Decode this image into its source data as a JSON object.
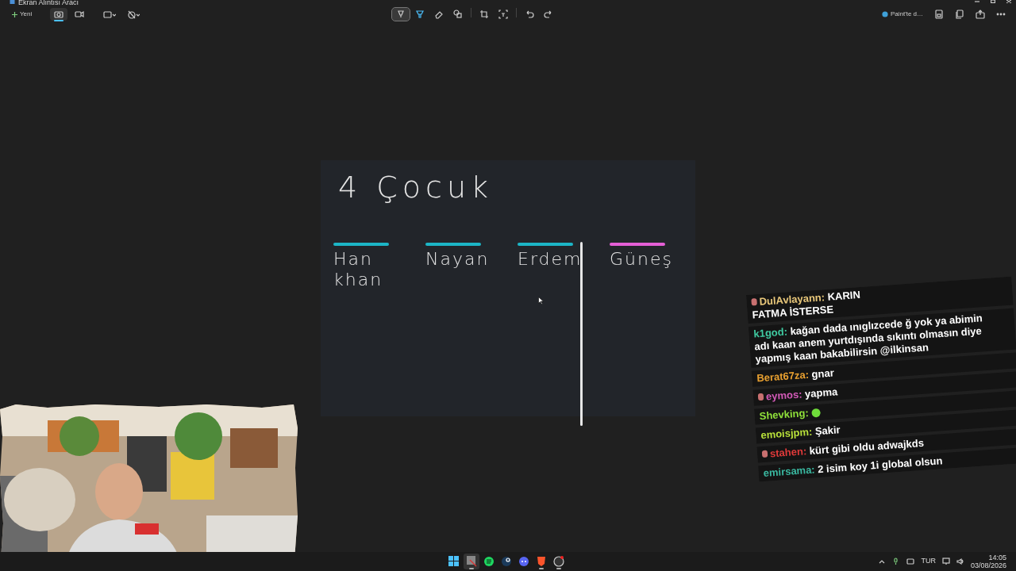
{
  "window": {
    "title": "Ekran Alıntısı Aracı"
  },
  "toolbar": {
    "new_button": "Yeni",
    "capture_modes": [
      {
        "selected": true
      },
      {
        "selected": false
      }
    ],
    "tools": [
      {
        "selected": true
      },
      {
        "selected": false
      },
      {
        "selected": false
      },
      {
        "selected": false
      }
    ],
    "paint_button": "Paint'te d…"
  },
  "canvas": {
    "heading": "4 Çocuk",
    "names": [
      {
        "lines": [
          "Han",
          "khan"
        ],
        "color": "#1cb5c6"
      },
      {
        "lines": [
          "Nayan"
        ],
        "color": "#1cb5c6"
      },
      {
        "lines": [
          "Erdem"
        ],
        "color": "#1cb5c6"
      },
      {
        "lines": [
          "Güneş"
        ],
        "color": "#e45fd6"
      }
    ]
  },
  "chat": [
    {
      "user": "DulAvlayann:",
      "color": "#e8c77a",
      "badge": true,
      "lines": [
        "KARIN",
        "FATMA İSTERSE"
      ]
    },
    {
      "user": "k1god:",
      "color": "#3fc9a0",
      "badge": false,
      "lines": [
        "kağan dada ınıglızcede ğ yok ya abimin",
        "adı kaan anem yurtdışında sıkıntı olmasın diye",
        "yapmış kaan bakabilirsin @ilkinsan"
      ]
    },
    {
      "user": "Berat67za:",
      "color": "#e8a030",
      "badge": false,
      "lines": [
        "gnar"
      ]
    },
    {
      "user": "eymos:",
      "color": "#d35ab8",
      "badge": true,
      "lines": [
        "yapma"
      ]
    },
    {
      "user": "Shevking:",
      "color": "#8fe03a",
      "badge": false,
      "emote": true
    },
    {
      "user": "emoisjpm:",
      "color": "#b8e03a",
      "badge": false,
      "lines": [
        "Şakir"
      ]
    },
    {
      "user": "stahen:",
      "color": "#e03a3a",
      "badge": true,
      "lines": [
        "kürt gibi oldu adwajkds"
      ]
    },
    {
      "user": "emirsama:",
      "color": "#3ab8a0",
      "badge": false,
      "lines": [
        "2 isim koy 1i global olsun"
      ]
    }
  ],
  "taskbar": {
    "apps": [
      {
        "active": false,
        "running": false
      },
      {
        "active": true,
        "running": true
      },
      {
        "active": false,
        "running": false
      },
      {
        "active": false,
        "running": false
      },
      {
        "active": false,
        "running": false
      },
      {
        "active": false,
        "running": true
      },
      {
        "active": false,
        "running": true
      }
    ],
    "language": "TUR",
    "time": "14:05",
    "date": "03/08/2026"
  }
}
